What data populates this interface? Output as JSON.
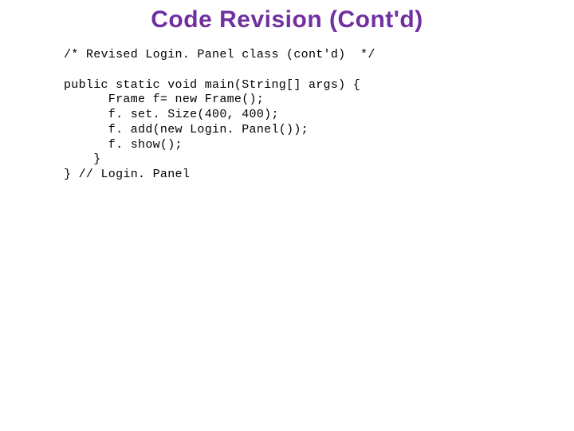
{
  "title": "Code Revision (Cont'd)",
  "code": {
    "comment": "/* Revised Login. Panel class (cont'd)  */",
    "line1": "public static void main(String[] args) {",
    "line2": "      Frame f= new Frame();",
    "line3": "      f. set. Size(400, 400);",
    "line4": "      f. add(new Login. Panel());",
    "line5": "      f. show();",
    "line6": "    }",
    "line7": "} // Login. Panel"
  }
}
